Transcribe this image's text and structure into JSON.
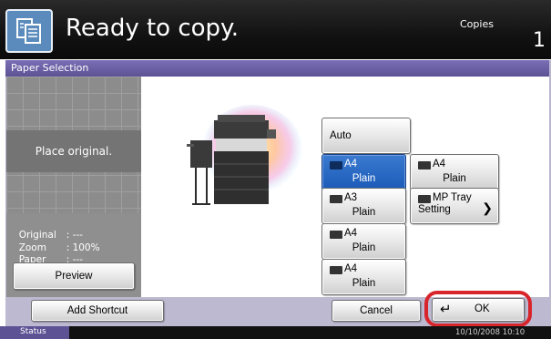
{
  "header": {
    "title": "Ready to copy.",
    "copies_label": "Copies",
    "copies_value": "1"
  },
  "panel": {
    "title": "Paper Selection"
  },
  "preview": {
    "message": "Place original.",
    "original_label": "Original",
    "original_value": ": ---",
    "zoom_label": "Zoom",
    "zoom_value": ": 100%",
    "paper_label": "Paper",
    "paper_value": ": ---",
    "preview_button": "Preview"
  },
  "paper_options": {
    "auto": "Auto",
    "cassette1": {
      "size": "A4",
      "type": "Plain",
      "selected": true
    },
    "cassette2": {
      "size": "A3",
      "type": "Plain"
    },
    "cassette3": {
      "size": "A4",
      "type": "Plain"
    },
    "cassette4": {
      "size": "A4",
      "type": "Plain"
    },
    "large_cassette": {
      "size": "A4",
      "type": "Plain"
    },
    "mp_tray": {
      "line1": "MP Tray",
      "line2": "Setting"
    }
  },
  "footer": {
    "add_shortcut": "Add Shortcut",
    "cancel": "Cancel",
    "ok": "OK"
  },
  "status": {
    "tab": "Status",
    "datetime": "10/10/2008   10:10"
  }
}
